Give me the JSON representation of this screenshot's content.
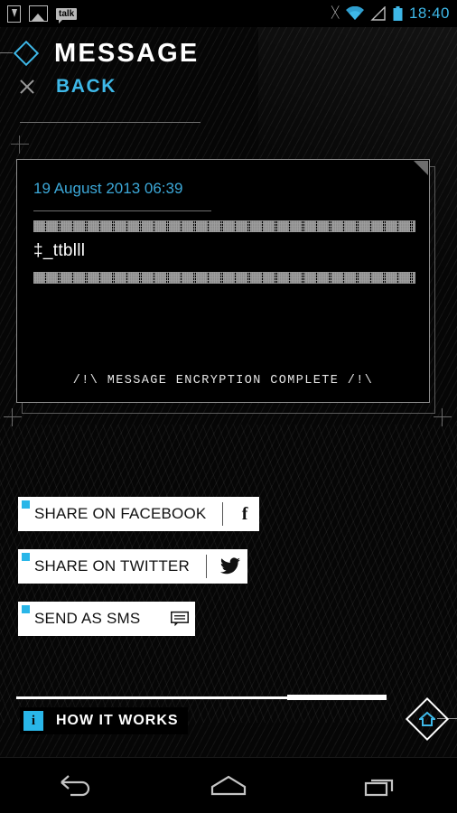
{
  "status_bar": {
    "time": "18:40",
    "left_icons": [
      {
        "name": "download-icon",
        "label": ""
      },
      {
        "name": "photo-icon",
        "label": ""
      },
      {
        "name": "talk-icon",
        "label": "talk"
      }
    ],
    "right_icons": [
      {
        "name": "bluetooth-icon"
      },
      {
        "name": "wifi-icon"
      },
      {
        "name": "signal-icon"
      },
      {
        "name": "battery-icon"
      }
    ]
  },
  "header": {
    "title": "MESSAGE",
    "back_label": "BACK"
  },
  "message_card": {
    "date": "19 August 2013 06:39",
    "body": "‡_ttblll",
    "footer": "/!\\ MESSAGE ENCRYPTION COMPLETE /!\\",
    "encrypted_rows": 2
  },
  "actions": [
    {
      "label": "SHARE ON FACEBOOK",
      "icon": "facebook-icon",
      "glyph": "f"
    },
    {
      "label": "SHARE ON TWITTER",
      "icon": "twitter-icon",
      "glyph": ""
    },
    {
      "label": "SEND AS SMS",
      "icon": "sms-icon",
      "glyph": ""
    }
  ],
  "bottom_bar": {
    "how_it_works": "HOW IT WORKS",
    "info_glyph": "i",
    "home_icon": "home-icon"
  },
  "nav_bar": {
    "back": "back-icon",
    "home": "home-icon",
    "recents": "recents-icon"
  },
  "colors": {
    "accent": "#3eb8e8",
    "accent_tag": "#29b6e8",
    "background": "#060606",
    "button_bg": "#ffffff"
  }
}
